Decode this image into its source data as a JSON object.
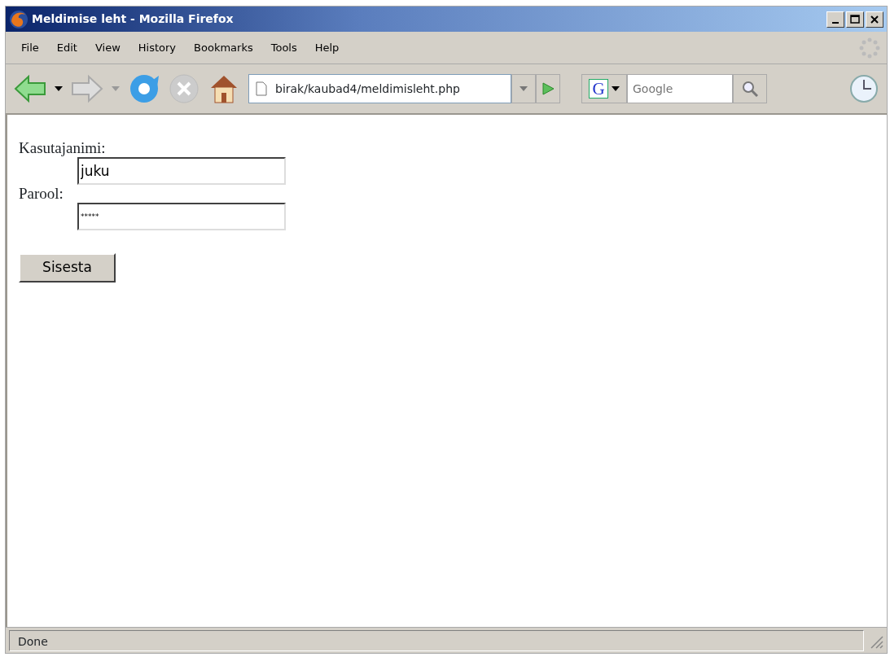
{
  "window": {
    "title": "Meldimise leht - Mozilla Firefox"
  },
  "menu": [
    "File",
    "Edit",
    "View",
    "History",
    "Bookmarks",
    "Tools",
    "Help"
  ],
  "address_bar": {
    "value": "birak/kaubad4/meldimisleht.php"
  },
  "search": {
    "engine_logo": "G",
    "placeholder": "Google"
  },
  "form": {
    "fields": [
      {
        "label": "Kasutajanimi:",
        "value": "juku",
        "kind": "text"
      },
      {
        "label": "Parool:",
        "value": "*****",
        "kind": "password"
      }
    ],
    "submit": "Sisesta"
  },
  "status_bar": "Done"
}
